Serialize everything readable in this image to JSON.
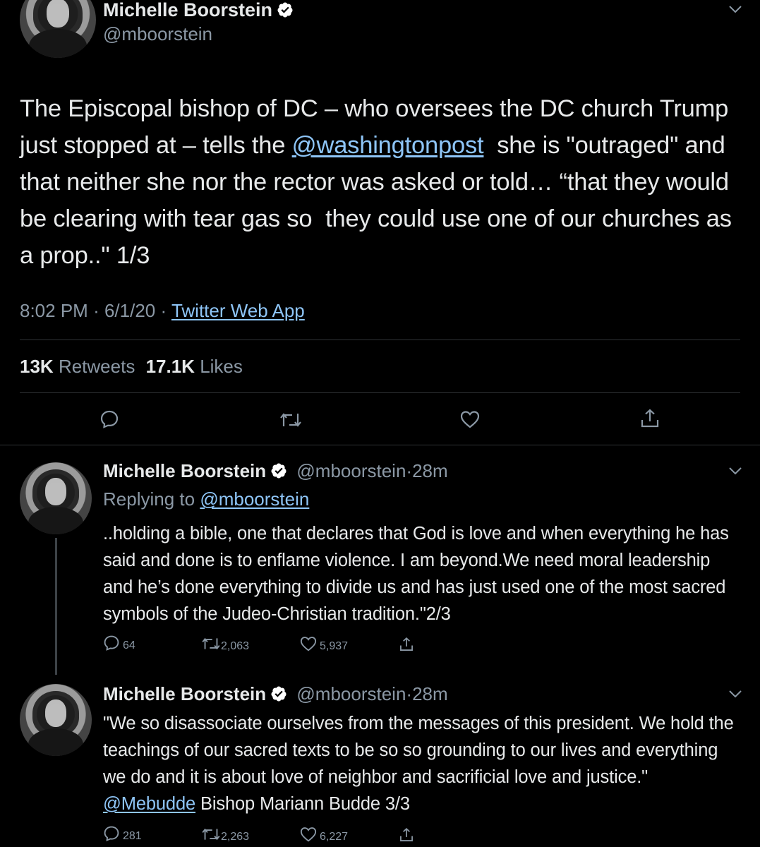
{
  "main_tweet": {
    "display_name": "Michelle Boorstein",
    "handle": "@mboorstein",
    "text_parts": {
      "p1": "The Episcopal bishop of DC – who oversees the DC church Trump just stopped at – tells the ",
      "mention": "@washingtonpost",
      "p2": "  she is \"outraged\" and that neither she nor the rector was asked or told… “that they would be clearing with tear gas so  they could use one of our churches as a prop..\" 1/3"
    },
    "time": "8:02 PM",
    "date": "6/1/20",
    "separator": "·",
    "source": "Twitter Web App",
    "retweets_count": "13K",
    "retweets_label": "Retweets",
    "likes_count": "17.1K",
    "likes_label": "Likes",
    "actions": [
      "reply-icon",
      "retweet-icon",
      "like-icon",
      "share-icon"
    ]
  },
  "replies": [
    {
      "display_name": "Michelle Boorstein",
      "handle": "@mboorstein",
      "time": "28m",
      "replying_label": "Replying to ",
      "replying_to": "@mboorstein",
      "text": "..holding a bible, one that declares that God is love and when everything he has said and done is to enflame violence. I am beyond.We need moral leadership and he’s done everything to divide us and has just used one of the most sacred symbols of the Judeo-Christian tradition.\"2/3",
      "reply_count": "64",
      "retweet_count": "2,063",
      "like_count": "5,937"
    },
    {
      "display_name": "Michelle Boorstein",
      "handle": "@mboorstein",
      "time": "28m",
      "text_before": "\"We so disassociate ourselves from the messages of this president. We hold the teachings of our sacred texts to be so so grounding to our lives and everything we do and it is about love of neighbor and sacrificial love and justice.\" ",
      "mention": "@Mebudde",
      "text_after": " Bishop Mariann Budde 3/3",
      "reply_count": "281",
      "retweet_count": "2,263",
      "like_count": "6,227"
    }
  ],
  "colors": {
    "background": "#000000",
    "text": "#e7e9ea",
    "muted": "#8b98a5",
    "link": "#8ec5f7",
    "verified": "#ffffff",
    "divider": "#2f3336"
  }
}
